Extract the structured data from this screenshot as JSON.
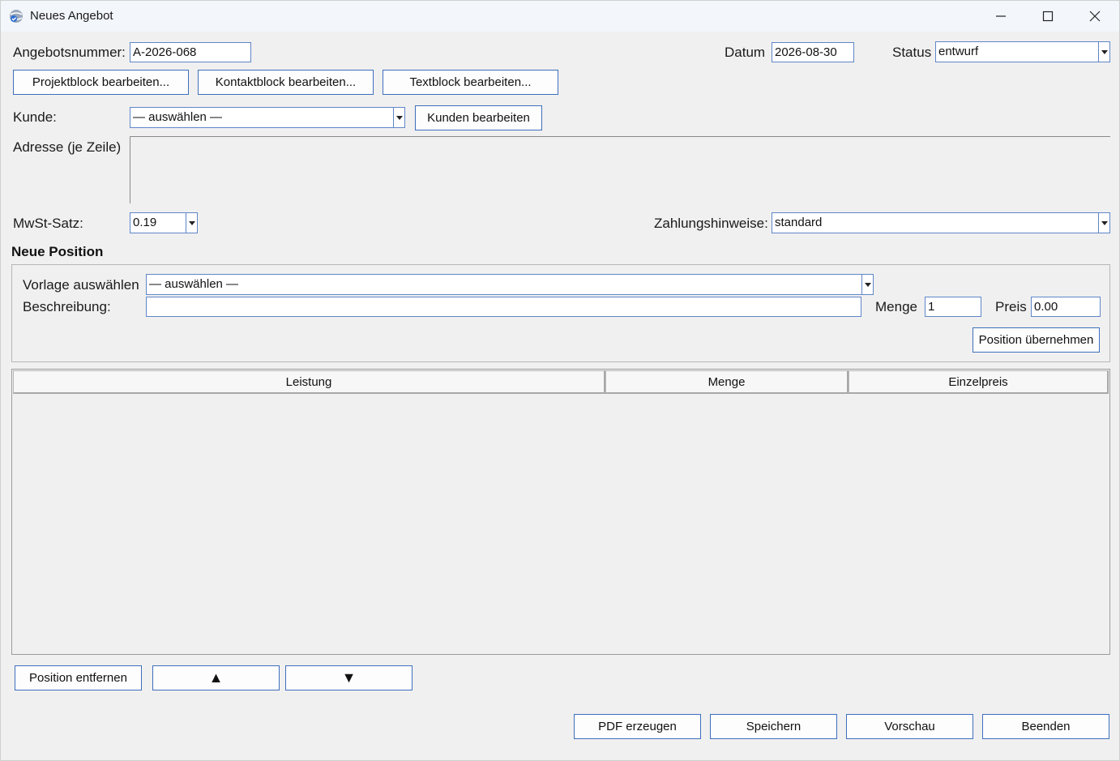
{
  "window": {
    "title": "Neues Angebot"
  },
  "header": {
    "number_label": "Angebotsnummer:",
    "number_value": "A-2026-068",
    "date_label": "Datum",
    "date_value": "2026-08-30",
    "status_label": "Status",
    "status_value": "entwurf"
  },
  "blocks": {
    "project": "Projektblock bearbeiten...",
    "contact": "Kontaktblock bearbeiten...",
    "text": "Textblock bearbeiten..."
  },
  "customer": {
    "label": "Kunde:",
    "value": "— auswählen —",
    "edit_button": "Kunden bearbeiten",
    "address_label": "Adresse (je Zeile)",
    "address_value": ""
  },
  "tax": {
    "label": "MwSt-Satz:",
    "value": "0.19"
  },
  "payment": {
    "label": "Zahlungshinweise:",
    "value": "standard"
  },
  "position": {
    "section_title": "Neue Position",
    "template_label": "Vorlage auswählen",
    "template_value": "— auswählen —",
    "description_label": "Beschreibung:",
    "description_value": "",
    "quantity_label": "Menge",
    "quantity_value": "1",
    "price_label": "Preis",
    "price_value": "0.00",
    "apply_button": "Position übernehmen"
  },
  "table": {
    "columns": [
      "Leistung",
      "Menge",
      "Einzelpreis"
    ],
    "rows": []
  },
  "row_actions": {
    "remove": "Position entfernen",
    "up": "▲",
    "down": "▼"
  },
  "footer": {
    "pdf": "PDF erzeugen",
    "save": "Speichern",
    "preview": "Vorschau",
    "quit": "Beenden"
  },
  "colors": {
    "accent_border": "#3e6fbd",
    "field_border": "#5f86c8"
  }
}
